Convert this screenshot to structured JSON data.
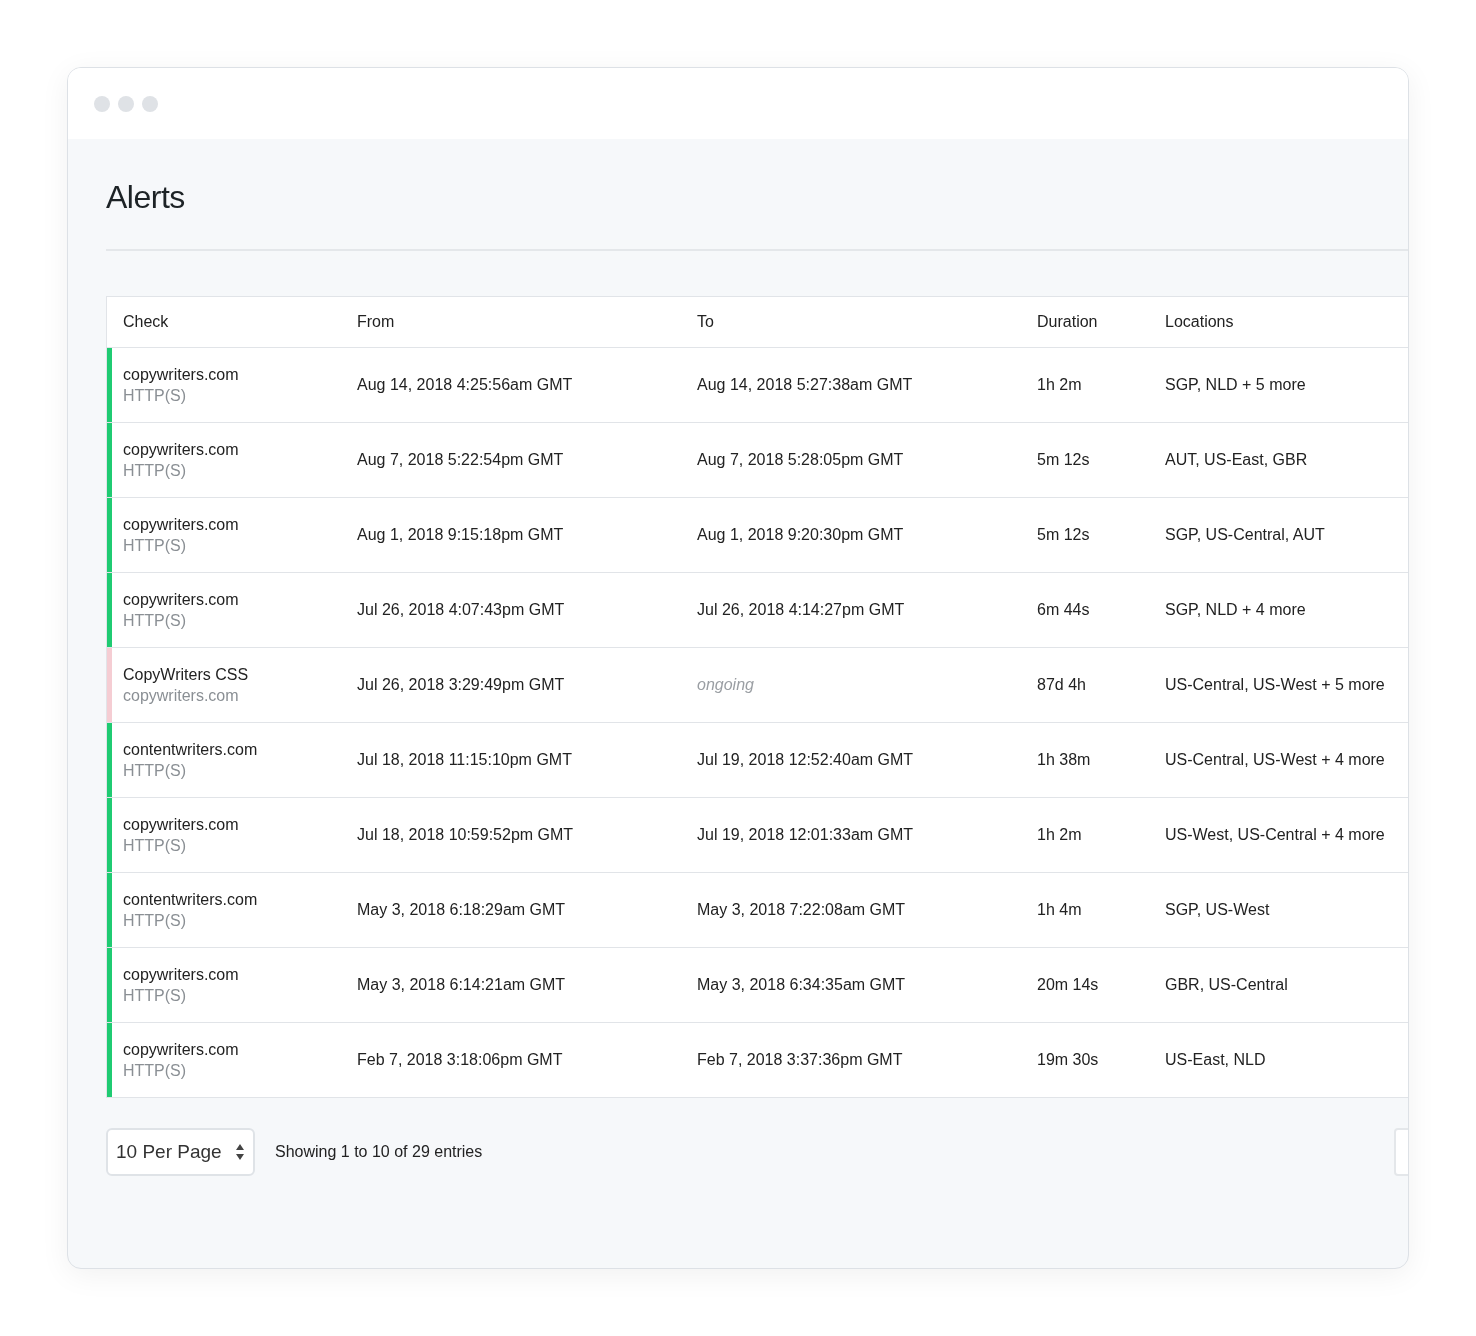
{
  "page": {
    "title": "Alerts"
  },
  "table": {
    "columns": [
      "Check",
      "From",
      "To",
      "Duration",
      "Locations"
    ],
    "rows": [
      {
        "color": "#1fcb72",
        "name": "copywriters.com",
        "type": "HTTP(S)",
        "from": "Aug 14, 2018 4:25:56am GMT",
        "to": "Aug 14, 2018 5:27:38am GMT",
        "ongoing": false,
        "duration": "1h 2m",
        "locations": "SGP, NLD + 5 more"
      },
      {
        "color": "#1fcb72",
        "name": "copywriters.com",
        "type": "HTTP(S)",
        "from": "Aug 7, 2018 5:22:54pm GMT",
        "to": "Aug 7, 2018 5:28:05pm GMT",
        "ongoing": false,
        "duration": "5m 12s",
        "locations": "AUT, US-East, GBR"
      },
      {
        "color": "#1fcb72",
        "name": "copywriters.com",
        "type": "HTTP(S)",
        "from": "Aug 1, 2018 9:15:18pm GMT",
        "to": "Aug 1, 2018 9:20:30pm GMT",
        "ongoing": false,
        "duration": "5m 12s",
        "locations": "SGP, US-Central, AUT"
      },
      {
        "color": "#1fcb72",
        "name": "copywriters.com",
        "type": "HTTP(S)",
        "from": "Jul 26, 2018 4:07:43pm GMT",
        "to": "Jul 26, 2018 4:14:27pm GMT",
        "ongoing": false,
        "duration": "6m 44s",
        "locations": "SGP, NLD + 4 more"
      },
      {
        "color": "#f5cdd3",
        "name": "CopyWriters CSS",
        "type": "copywriters.com",
        "from": "Jul 26, 2018 3:29:49pm GMT",
        "to": "ongoing",
        "ongoing": true,
        "duration": "87d 4h",
        "locations": "US-Central, US-West + 5 more"
      },
      {
        "color": "#1fcb72",
        "name": "contentwriters.com",
        "type": "HTTP(S)",
        "from": "Jul 18, 2018 11:15:10pm GMT",
        "to": "Jul 19, 2018 12:52:40am GMT",
        "ongoing": false,
        "duration": "1h 38m",
        "locations": "US-Central, US-West + 4 more"
      },
      {
        "color": "#1fcb72",
        "name": "copywriters.com",
        "type": "HTTP(S)",
        "from": "Jul 18, 2018 10:59:52pm GMT",
        "to": "Jul 19, 2018 12:01:33am GMT",
        "ongoing": false,
        "duration": "1h 2m",
        "locations": "US-West, US-Central + 4 more"
      },
      {
        "color": "#1fcb72",
        "name": "contentwriters.com",
        "type": "HTTP(S)",
        "from": "May 3, 2018 6:18:29am GMT",
        "to": "May 3, 2018 7:22:08am GMT",
        "ongoing": false,
        "duration": "1h 4m",
        "locations": "SGP, US-West"
      },
      {
        "color": "#1fcb72",
        "name": "copywriters.com",
        "type": "HTTP(S)",
        "from": "May 3, 2018 6:14:21am GMT",
        "to": "May 3, 2018 6:34:35am GMT",
        "ongoing": false,
        "duration": "20m 14s",
        "locations": "GBR, US-Central"
      },
      {
        "color": "#1fcb72",
        "name": "copywriters.com",
        "type": "HTTP(S)",
        "from": "Feb 7, 2018 3:18:06pm GMT",
        "to": "Feb 7, 2018 3:37:36pm GMT",
        "ongoing": false,
        "duration": "19m 30s",
        "locations": "US-East, NLD"
      }
    ]
  },
  "footer": {
    "per_page": "10 Per Page",
    "summary": "Showing 1 to 10 of 29 entries"
  }
}
